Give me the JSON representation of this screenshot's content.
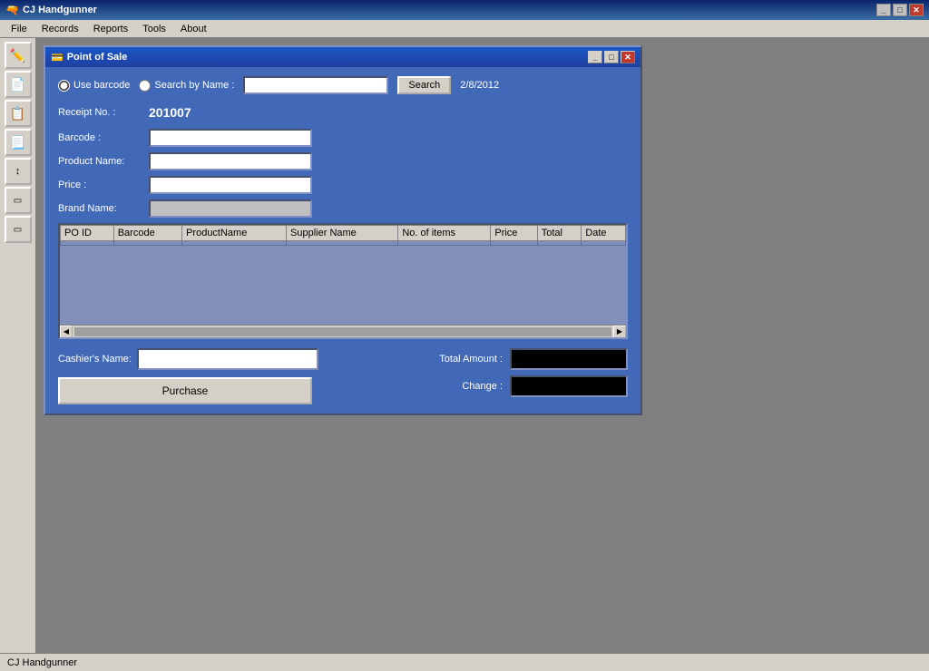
{
  "app": {
    "title": "CJ Handgunner",
    "icon": "🔫",
    "status_bar_text": "CJ Handgunner"
  },
  "menu": {
    "items": [
      "File",
      "Records",
      "Reports",
      "Tools",
      "About"
    ]
  },
  "sidebar": {
    "buttons": [
      {
        "name": "edit-icon",
        "symbol": "✏️"
      },
      {
        "name": "document1-icon",
        "symbol": "📄"
      },
      {
        "name": "document2-icon",
        "symbol": "📋"
      },
      {
        "name": "document3-icon",
        "symbol": "📃"
      },
      {
        "name": "nav-icon",
        "symbol": "↕"
      },
      {
        "name": "box1-icon",
        "symbol": "▭"
      },
      {
        "name": "box2-icon",
        "symbol": "▭"
      }
    ]
  },
  "dialog": {
    "title": "Point of Sale",
    "icon": "💳",
    "controls": {
      "minimize": "_",
      "maximize": "□",
      "close": "✕"
    },
    "radio": {
      "use_barcode_label": "Use barcode",
      "search_by_name_label": "Search by Name :",
      "search_name_placeholder": "",
      "search_btn_label": "Search",
      "date": "2/8/2012"
    },
    "form": {
      "receipt_label": "Receipt No. :",
      "receipt_value": "201007",
      "barcode_label": "Barcode :",
      "product_name_label": "Product Name:",
      "price_label": "Price :",
      "brand_name_label": "Brand Name:"
    },
    "table": {
      "columns": [
        "PO ID",
        "Barcode",
        "ProductName",
        "Supplier Name",
        "No. of items",
        "Price",
        "Total",
        "Date"
      ],
      "rows": []
    },
    "cashier_label": "Cashier's Name:",
    "purchase_btn_label": "Purchase",
    "total_amount_label": "Total Amount :",
    "change_label": "Change :"
  }
}
